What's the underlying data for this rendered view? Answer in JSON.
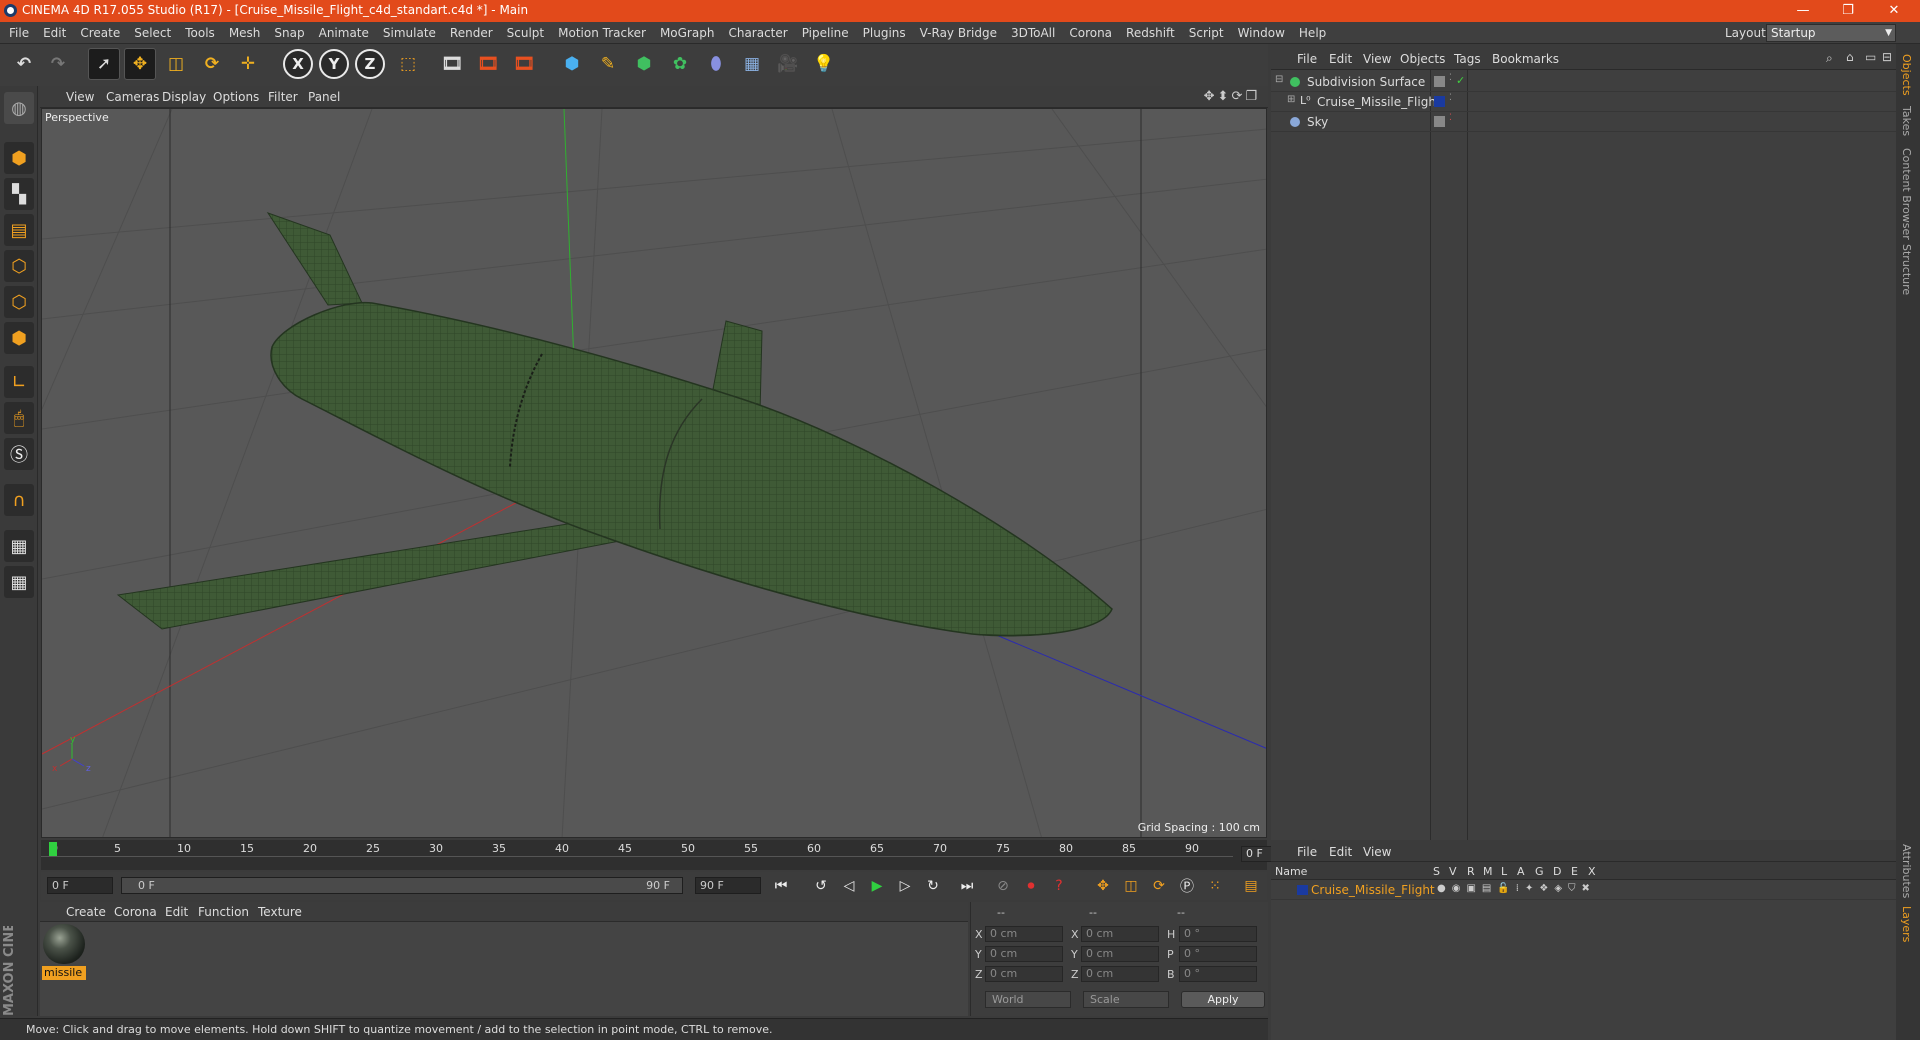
{
  "app": {
    "title": "CINEMA 4D R17.055 Studio (R17) - [Cruise_Missile_Flight_c4d_standart.c4d *] - Main",
    "layout_label": "Layout:",
    "layout_value": "Startup"
  },
  "menu": [
    "File",
    "Edit",
    "Create",
    "Select",
    "Tools",
    "Mesh",
    "Snap",
    "Animate",
    "Simulate",
    "Render",
    "Sculpt",
    "Motion Tracker",
    "MoGraph",
    "Character",
    "Pipeline",
    "Plugins",
    "V-Ray Bridge",
    "3DToAll",
    "Corona",
    "Redshift",
    "Script",
    "Window",
    "Help"
  ],
  "viewport": {
    "menu": [
      "View",
      "Cameras",
      "Display",
      "Options",
      "Filter",
      "Panel"
    ],
    "label": "Perspective",
    "grid_spacing": "Grid Spacing : 100 cm"
  },
  "timeline": {
    "ticks": [
      "0",
      "5",
      "10",
      "15",
      "20",
      "25",
      "30",
      "35",
      "40",
      "45",
      "50",
      "55",
      "60",
      "65",
      "70",
      "75",
      "80",
      "85",
      "90"
    ],
    "current_frame": "0 F",
    "start_field": "0 F",
    "range_start": "0 F",
    "range_end": "90 F",
    "end_field": "90 F"
  },
  "materials": {
    "menu": [
      "Create",
      "Corona",
      "Edit",
      "Function",
      "Texture"
    ],
    "items": [
      {
        "name": "missile"
      }
    ]
  },
  "coords": {
    "headers": [
      "--",
      "--",
      "--"
    ],
    "rows": [
      {
        "a": "X",
        "av": "0 cm",
        "b": "X",
        "bv": "0 cm",
        "c": "H",
        "cv": "0 °"
      },
      {
        "a": "Y",
        "av": "0 cm",
        "b": "Y",
        "bv": "0 cm",
        "c": "P",
        "cv": "0 °"
      },
      {
        "a": "Z",
        "av": "0 cm",
        "b": "Z",
        "bv": "0 cm",
        "c": "B",
        "cv": "0 °"
      }
    ],
    "mode": "World",
    "transform": "Scale",
    "apply": "Apply"
  },
  "status": "Move: Click and drag to move elements. Hold down SHIFT to quantize movement / add to the selection in point mode, CTRL to remove.",
  "objects": {
    "menu": [
      "File",
      "Edit",
      "View",
      "Objects",
      "Tags",
      "Bookmarks"
    ],
    "rows": [
      {
        "name": "Subdivision Surface"
      },
      {
        "name": "Cruise_Missile_Flight"
      },
      {
        "name": "Sky"
      }
    ]
  },
  "layers": {
    "menu": [
      "File",
      "Edit",
      "View"
    ],
    "columns": [
      "Name",
      "S",
      "V",
      "R",
      "M",
      "L",
      "A",
      "G",
      "D",
      "E",
      "X"
    ],
    "rows": [
      {
        "name": "Cruise_Missile_Flight"
      }
    ]
  },
  "right_tabs": [
    "Objects",
    "Takes",
    "Content Browser",
    "Structure",
    "Attributes",
    "Layers"
  ],
  "brand": "MAXON CINEMA 4D",
  "colors": {
    "titlebar": "#e24a1b",
    "accent": "#f0a020",
    "selection": "#f0a020"
  }
}
